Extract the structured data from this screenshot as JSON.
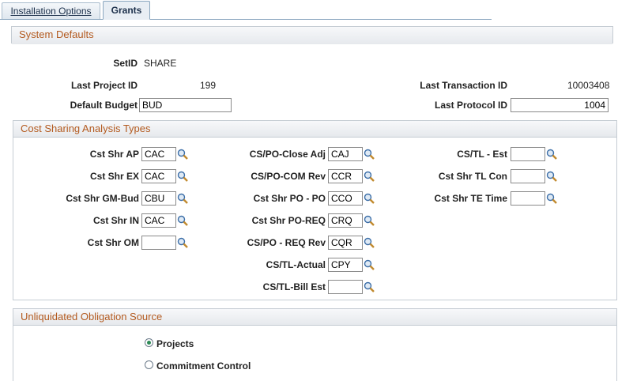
{
  "tabs": {
    "installation_options": "Installation Options",
    "grants": "Grants"
  },
  "system_defaults": {
    "title": "System Defaults",
    "setid_label": "SetID",
    "setid_value": "SHARE",
    "last_project_id_label": "Last Project ID",
    "last_project_id_value": "199",
    "last_transaction_id_label": "Last Transaction ID",
    "last_transaction_id_value": "10003408",
    "default_budget_label": "Default Budget",
    "default_budget_value": "BUD",
    "last_protocol_id_label": "Last Protocol ID",
    "last_protocol_id_value": "1004"
  },
  "cost_sharing": {
    "title": "Cost Sharing Analysis Types",
    "col1": [
      {
        "label": "Cst Shr AP",
        "value": "CAC"
      },
      {
        "label": "Cst Shr EX",
        "value": "CAC"
      },
      {
        "label": "Cst Shr GM-Bud",
        "value": "CBU"
      },
      {
        "label": "Cst Shr IN",
        "value": "CAC"
      },
      {
        "label": "Cst Shr OM",
        "value": ""
      }
    ],
    "col2": [
      {
        "label": "CS/PO-Close Adj",
        "value": "CAJ"
      },
      {
        "label": "CS/PO-COM Rev",
        "value": "CCR"
      },
      {
        "label": "Cst Shr PO - PO",
        "value": "CCO"
      },
      {
        "label": "Cst Shr PO-REQ",
        "value": "CRQ"
      },
      {
        "label": "CS/PO - REQ Rev",
        "value": "CQR"
      },
      {
        "label": "CS/TL-Actual",
        "value": "CPY"
      },
      {
        "label": "CS/TL-Bill Est",
        "value": ""
      }
    ],
    "col3": [
      {
        "label": "CS/TL - Est",
        "value": ""
      },
      {
        "label": "Cst Shr TL Con",
        "value": ""
      },
      {
        "label": "Cst Shr TE Time",
        "value": ""
      }
    ]
  },
  "unliquidated": {
    "title": "Unliquidated Obligation Source",
    "projects_label": "Projects",
    "commitment_control_label": "Commitment Control",
    "selected": "projects"
  },
  "icons": {
    "lookup": "magnifier-lookup-icon"
  }
}
